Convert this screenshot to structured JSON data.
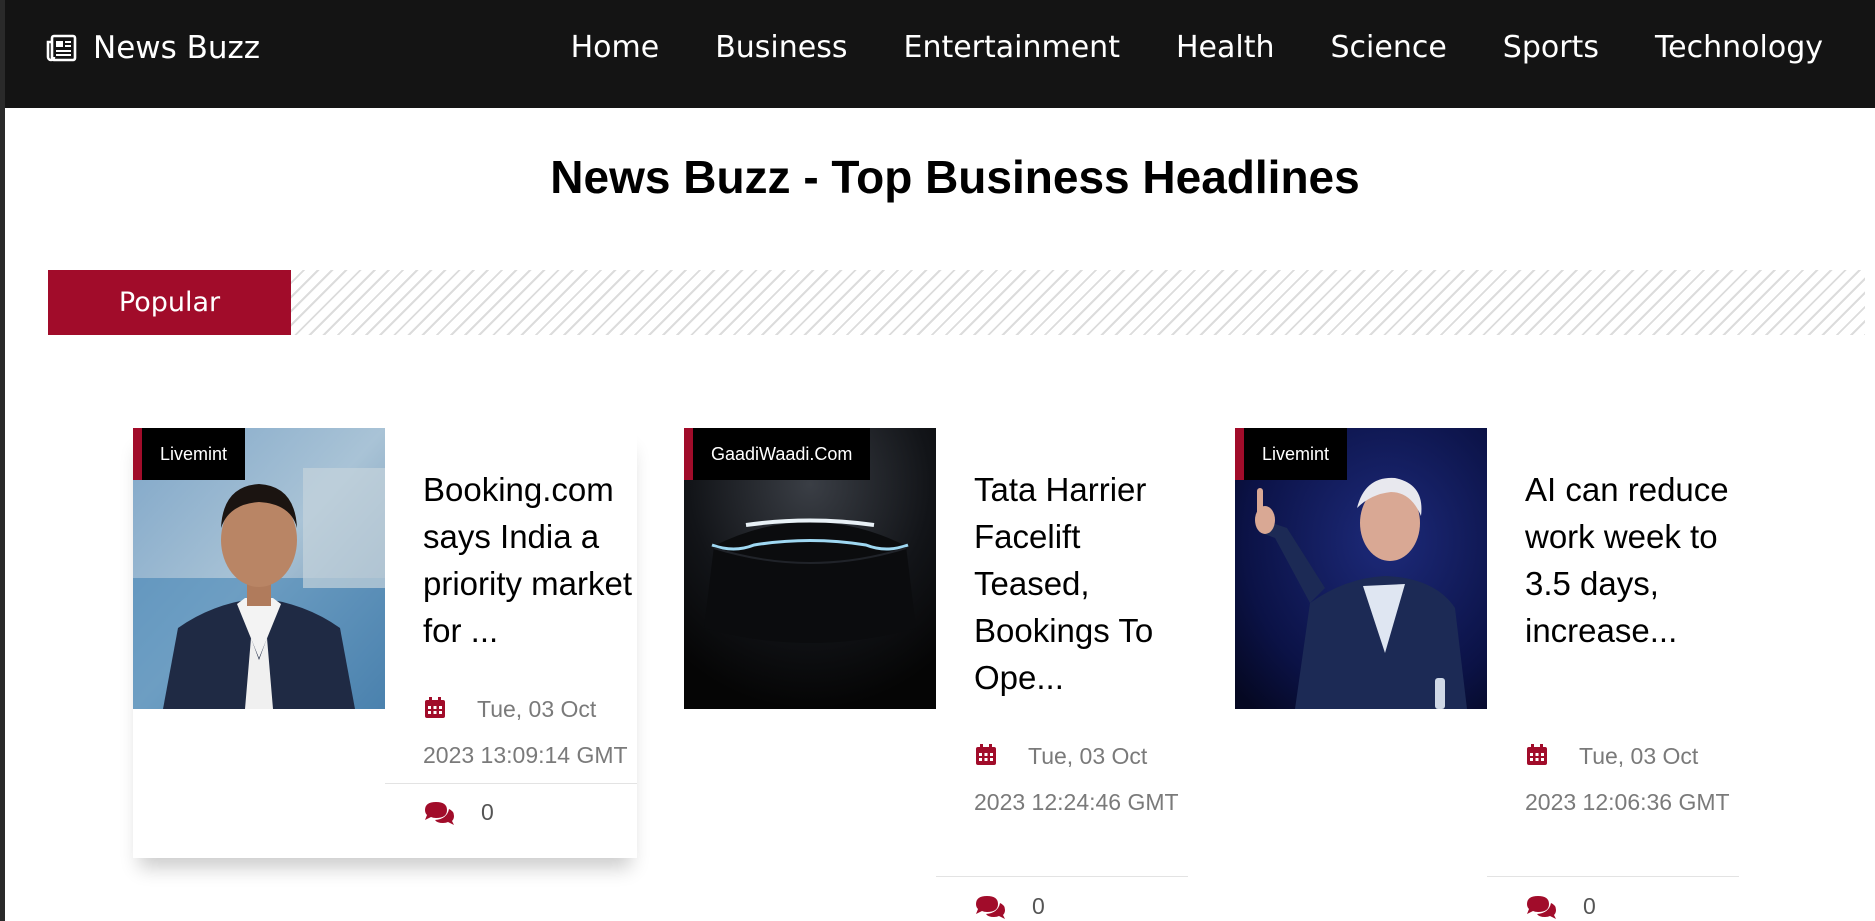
{
  "brand": {
    "name": "News Buzz",
    "icon": "newspaper-icon"
  },
  "nav": [
    "Home",
    "Business",
    "Entertainment",
    "Health",
    "Science",
    "Sports",
    "Technology"
  ],
  "page_title": "News Buzz - Top Business Headlines",
  "section": {
    "label": "Popular"
  },
  "articles": [
    {
      "source": "Livemint",
      "headline": "Booking.com says India a priority market for ...",
      "date": "Tue, 03 Oct 2023 13:09:14 GMT",
      "comments": "0"
    },
    {
      "source": "GaadiWaadi.Com",
      "headline": "Tata Harrier Facelift Teased, Bookings To Ope...",
      "date": "Tue, 03 Oct 2023 12:24:46 GMT",
      "comments": "0"
    },
    {
      "source": "Livemint",
      "headline": "AI can reduce work week to 3.5 days, increase...",
      "date": "Tue, 03 Oct 2023 12:06:36 GMT",
      "comments": "0"
    }
  ],
  "colors": {
    "accent": "#a10c2a",
    "navbar": "#141414"
  }
}
